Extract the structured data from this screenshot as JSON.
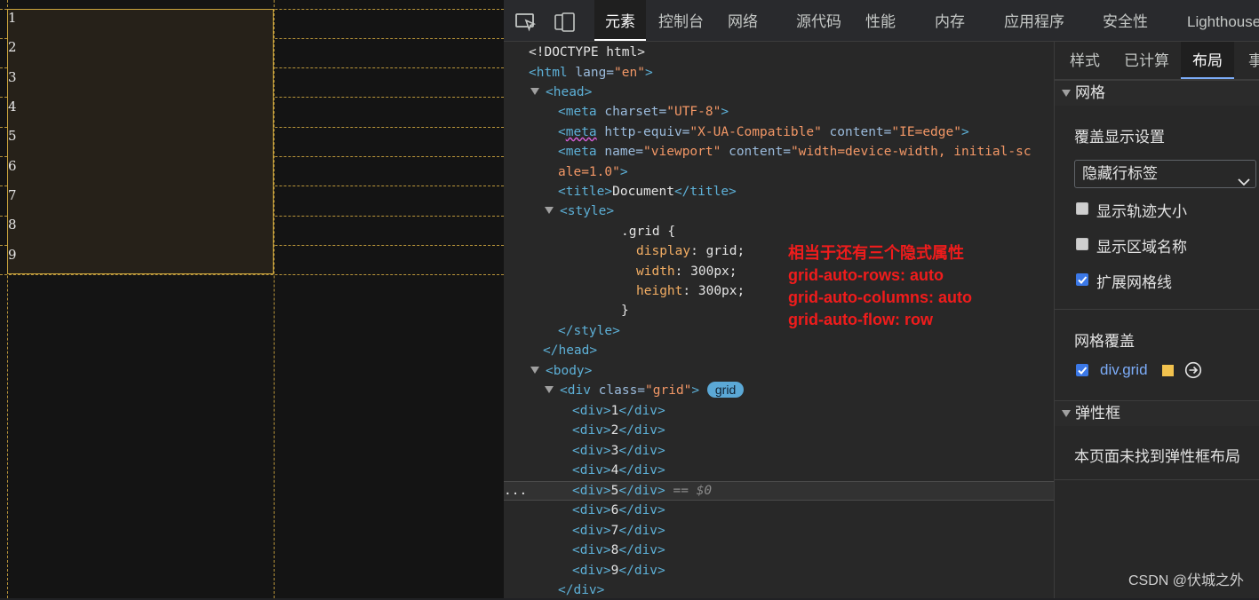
{
  "viewport": {
    "cells": [
      "1",
      "2",
      "3",
      "4",
      "5",
      "6",
      "7",
      "8",
      "9"
    ]
  },
  "toolbar": {
    "tabs": [
      "元素",
      "控制台",
      "网络",
      "源代码",
      "性能",
      "内存",
      "应用程序",
      "安全性",
      "Lighthouse"
    ],
    "active_tab": "元素"
  },
  "code": {
    "doctype": "<!DOCTYPE html>",
    "html_open_tag": "<html",
    "html_lang_attr": " lang=",
    "html_lang_val": "\"en\"",
    "gt": ">",
    "head_open": "<head>",
    "meta_open": "<meta",
    "meta_word": "meta",
    "charset_attr": " charset=",
    "charset_val": "\"UTF-8\"",
    "httpequiv_attr": " http-equiv=",
    "httpequiv_val": "\"X-UA-Compatible\"",
    "content_attr": " content=",
    "content_val1": "\"IE=edge\"",
    "name_attr": " name=",
    "name_val": "\"viewport\"",
    "content_val2_a": "\"width=device-width, initial-sc",
    "content_val2_b": "ale=1.0\"",
    "title_open": "<title>",
    "title_text": "Document",
    "title_close": "</title>",
    "style_open": "<style>",
    "css_selector": ".grid {",
    "css_prop1": "display",
    "css_val1": "grid;",
    "css_prop2": "width",
    "css_val2": "300px;",
    "css_prop3": "height",
    "css_val3": "300px;",
    "css_close": "}",
    "colon": ": ",
    "style_close": "</style>",
    "head_close": "</head>",
    "body_open": "<body>",
    "div_open_tag": "<div",
    "class_attr": " class=",
    "class_val": "\"grid\"",
    "grid_badge": "grid",
    "div_children": [
      "1",
      "2",
      "3",
      "4",
      "5",
      "6",
      "7",
      "8",
      "9"
    ],
    "div_lt": "<div>",
    "div_ct": "</div>",
    "selected_marker": " == $0",
    "gutter_dots": "...",
    "div_close": "</div>"
  },
  "annotation": {
    "lines": [
      "相当于还有三个隐式属性",
      "grid-auto-rows: auto",
      "grid-auto-columns: auto",
      "grid-auto-flow: row"
    ]
  },
  "side": {
    "tabs": [
      "样式",
      "已计算",
      "布局",
      "事"
    ],
    "active_tab": "布局",
    "grid_section": "网格",
    "overlay_settings": "覆盖显示设置",
    "select_value": "隐藏行标签",
    "cb_track": "显示轨迹大小",
    "cb_area": "显示区域名称",
    "cb_extend": "扩展网格线",
    "grid_overlay": "网格覆盖",
    "overlay_item": "div.grid",
    "flex_section": "弹性框",
    "flex_empty": "本页面未找到弹性框布局"
  },
  "watermark": "CSDN @伏城之外",
  "colors": {
    "annotation": "#f01c1c",
    "grid_line": "#b9953a",
    "swatch": "#f2c24e",
    "checkbox_on": "#3b78e7"
  }
}
